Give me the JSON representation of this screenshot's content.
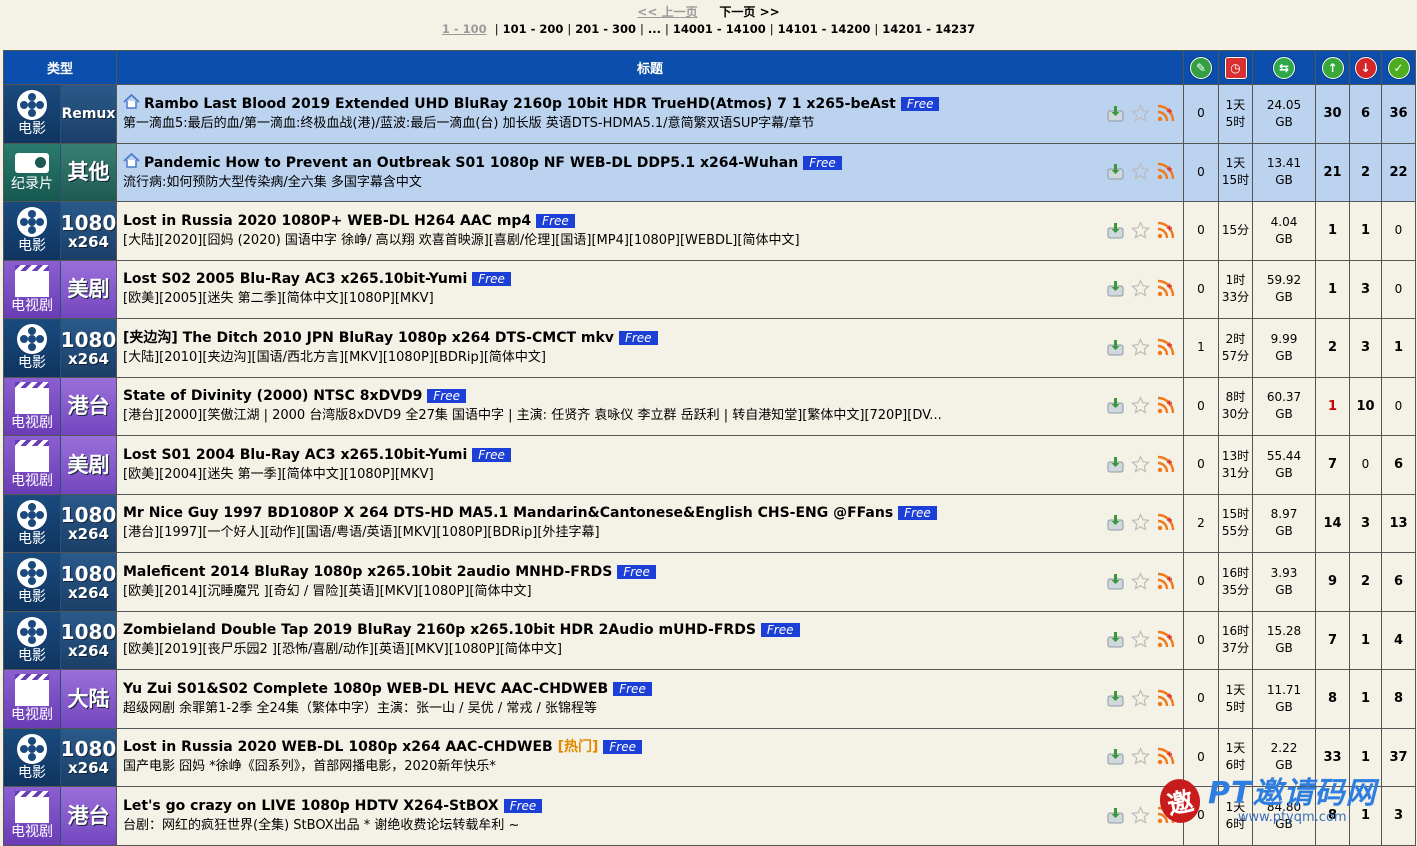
{
  "pager": {
    "prev_label": "<< 上一页",
    "next_label": "下一页 >>",
    "current": "1 - 100",
    "pages": [
      "101 - 200",
      "201 - 300",
      "...",
      "14001 - 14100",
      "14101 - 14200",
      "14201 - 14237"
    ]
  },
  "table": {
    "col_type": "类型",
    "col_title": "标题"
  },
  "rows": [
    {
      "cat_label": "电影",
      "cat_tag": "Remux",
      "cat_tag2": "",
      "title": "Rambo Last Blood 2019 Extended UHD BluRay 2160p 10bit HDR TrueHD(Atmos) 7 1 x265-beAst",
      "free": "Free",
      "hot": "",
      "subtitle": "第一滴血5:最后的血/第一滴血:终极血战(港)/蓝波:最后一滴血(台) 加长版 英语DTS-HDMA5.1/意简繁双语SUP字幕/章节",
      "comments": "0",
      "time": [
        "1天",
        "5时"
      ],
      "size": [
        "24.05",
        "GB"
      ],
      "seeders": "30",
      "leechers": "6",
      "completed": "36"
    },
    {
      "cat_label": "纪录片",
      "cat_tag": "其他",
      "cat_tag2": "",
      "title": "Pandemic How to Prevent an Outbreak S01 1080p NF WEB-DL DDP5.1 x264-Wuhan",
      "free": "Free",
      "hot": "",
      "subtitle": "流行病:如何预防大型传染病/全六集 多国字幕含中文",
      "comments": "0",
      "time": [
        "1天",
        "15时"
      ],
      "size": [
        "13.41",
        "GB"
      ],
      "seeders": "21",
      "leechers": "2",
      "completed": "22"
    },
    {
      "cat_label": "电影",
      "cat_tag": "1080",
      "cat_tag2": "x264",
      "title": "Lost in Russia 2020 1080P+ WEB-DL H264 AAC mp4",
      "free": "Free",
      "hot": "",
      "subtitle": "[大陆][2020][囧妈 (2020) 国语中字 徐峥/ 高以翔 欢喜首映源][喜剧/伦理][国语][MP4][1080P][WEBDL][简体中文]",
      "comments": "0",
      "time": [
        "15分",
        ""
      ],
      "size": [
        "4.04",
        "GB"
      ],
      "seeders": "1",
      "leechers": "1",
      "completed": "0"
    },
    {
      "cat_label": "电视剧",
      "cat_tag": "美剧",
      "cat_tag2": "",
      "title": "Lost S02 2005 Blu-Ray AC3 x265.10bit-Yumi",
      "free": "Free",
      "hot": "",
      "subtitle": "[欧美][2005][迷失 第二季][简体中文][1080P][MKV]",
      "comments": "0",
      "time": [
        "1时",
        "33分"
      ],
      "size": [
        "59.92",
        "GB"
      ],
      "seeders": "1",
      "leechers": "3",
      "completed": "0"
    },
    {
      "cat_label": "电影",
      "cat_tag": "1080",
      "cat_tag2": "x264",
      "title": "[夹边沟] The Ditch 2010 JPN BluRay 1080p x264 DTS-CMCT mkv",
      "free": "Free",
      "hot": "",
      "subtitle": "[大陆][2010][夹边沟][国语/西北方言][MKV][1080P][BDRip][简体中文]",
      "comments": "1",
      "time": [
        "2时",
        "57分"
      ],
      "size": [
        "9.99",
        "GB"
      ],
      "seeders": "2",
      "leechers": "3",
      "completed": "1"
    },
    {
      "cat_label": "电视剧",
      "cat_tag": "港台",
      "cat_tag2": "",
      "title": "State of Divinity (2000) NTSC 8xDVD9",
      "free": "Free",
      "hot": "",
      "subtitle": "[港台][2000][笑傲江湖 | 2000 台湾版8xDVD9 全27集 国语中字 | 主演: 任贤齐 袁咏仪 李立群 岳跃利 | 转自港知堂][繁体中文][720P][DV...",
      "comments": "0",
      "time": [
        "8时",
        "30分"
      ],
      "size": [
        "60.37",
        "GB"
      ],
      "seeders": "1",
      "seeders_red": true,
      "leechers": "10",
      "completed": "0"
    },
    {
      "cat_label": "电视剧",
      "cat_tag": "美剧",
      "cat_tag2": "",
      "title": "Lost S01 2004 Blu-Ray AC3 x265.10bit-Yumi",
      "free": "Free",
      "hot": "",
      "subtitle": "[欧美][2004][迷失 第一季][简体中文][1080P][MKV]",
      "comments": "0",
      "time": [
        "13时",
        "31分"
      ],
      "size": [
        "55.44",
        "GB"
      ],
      "seeders": "7",
      "leechers": "0",
      "completed": "6"
    },
    {
      "cat_label": "电影",
      "cat_tag": "1080",
      "cat_tag2": "x264",
      "title": "Mr Nice Guy 1997 BD1080P X 264 DTS-HD MA5.1 Mandarin&Cantonese&English CHS-ENG @FFans",
      "free": "Free",
      "hot": "",
      "subtitle": "[港台][1997][一个好人][动作][国语/粤语/英语][MKV][1080P][BDRip][外挂字幕]",
      "comments": "2",
      "time": [
        "15时",
        "55分"
      ],
      "size": [
        "8.97",
        "GB"
      ],
      "seeders": "14",
      "leechers": "3",
      "completed": "13"
    },
    {
      "cat_label": "电影",
      "cat_tag": "1080",
      "cat_tag2": "x264",
      "title": "Maleficent 2014 BluRay 1080p x265.10bit 2audio MNHD-FRDS",
      "free": "Free",
      "hot": "",
      "subtitle": "[欧美][2014][沉睡魔咒 ][奇幻 / 冒险][英语][MKV][1080P][简体中文]",
      "comments": "0",
      "time": [
        "16时",
        "35分"
      ],
      "size": [
        "3.93",
        "GB"
      ],
      "seeders": "9",
      "leechers": "2",
      "completed": "6"
    },
    {
      "cat_label": "电影",
      "cat_tag": "1080",
      "cat_tag2": "x264",
      "title": "Zombieland Double Tap 2019 BluRay 2160p x265.10bit HDR 2Audio mUHD-FRDS",
      "free": "Free",
      "hot": "",
      "subtitle": "[欧美][2019][丧尸乐园2 ][恐怖/喜剧/动作][英语][MKV][1080P][简体中文]",
      "comments": "0",
      "time": [
        "16时",
        "37分"
      ],
      "size": [
        "15.28",
        "GB"
      ],
      "seeders": "7",
      "leechers": "1",
      "completed": "4"
    },
    {
      "cat_label": "电视剧",
      "cat_tag": "大陆",
      "cat_tag2": "",
      "title": "Yu Zui S01&S02 Complete 1080p WEB-DL HEVC AAC-CHDWEB",
      "free": "Free",
      "hot": "",
      "subtitle": "超级网剧 余罪第1-2季 全24集（繁体中字）主演：张一山 / 吴优 / 常戎 / 张锦程等",
      "comments": "0",
      "time": [
        "1天",
        "5时"
      ],
      "size": [
        "11.71",
        "GB"
      ],
      "seeders": "8",
      "leechers": "1",
      "completed": "8"
    },
    {
      "cat_label": "电影",
      "cat_tag": "1080",
      "cat_tag2": "x264",
      "title": "Lost in Russia 2020 WEB-DL 1080p x264 AAC-CHDWEB",
      "free": "Free",
      "hot": "热门",
      "subtitle": "国产电影 囧妈 *徐峥《囧系列》，首部网播电影，2020新年快乐*",
      "comments": "0",
      "time": [
        "1天",
        "6时"
      ],
      "size": [
        "2.22",
        "GB"
      ],
      "seeders": "33",
      "leechers": "1",
      "completed": "37"
    },
    {
      "cat_label": "电视剧",
      "cat_tag": "港台",
      "cat_tag2": "",
      "title": "Let's go crazy on LIVE 1080p HDTV X264-StBOX",
      "free": "Free",
      "hot": "",
      "subtitle": "台剧：网红的疯狂世界(全集)    StBOX出品     * 谢绝收费论坛转载牟利 ~",
      "comments": "0",
      "time": [
        "1天",
        "6时"
      ],
      "size": [
        "84.80",
        "GB"
      ],
      "seeders": "8",
      "leechers": "1",
      "completed": "3"
    }
  ],
  "watermark": {
    "logo_char": "邀",
    "title": "PT邀请码网",
    "url": "www.ptyqm.com"
  },
  "colors": {
    "header_blue": "#0c4eab",
    "sticky_row": "#bcd3f0",
    "row_bg": "#f4f1e6",
    "free_badge": "#1c3fd8",
    "hot": "#e08a00"
  }
}
